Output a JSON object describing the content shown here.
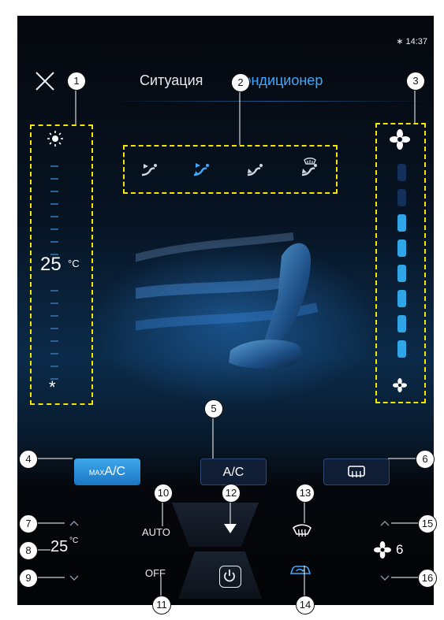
{
  "status_bar": {
    "bluetooth_icon": "bluetooth-icon",
    "time": "14:37"
  },
  "header": {
    "close_icon": "close-icon",
    "tabs": [
      {
        "label": "Ситуация",
        "active": false
      },
      {
        "label": "Кондиционер",
        "active": true
      }
    ]
  },
  "temperature_panel": {
    "sun_icon": "sun-icon",
    "value": "25",
    "unit": "°C",
    "snowflake_icon": "snowflake-icon"
  },
  "airflow_modes": [
    {
      "icon": "airflow-face-icon",
      "selected": false
    },
    {
      "icon": "airflow-face-feet-icon",
      "selected": true
    },
    {
      "icon": "airflow-feet-icon",
      "selected": false
    },
    {
      "icon": "airflow-feet-defrost-icon",
      "selected": false
    }
  ],
  "fan_panel": {
    "fan_icon_top": "fan-icon",
    "fan_icon_bottom": "fan-small-icon",
    "level": 6,
    "max_level": 8
  },
  "buttons": {
    "max_ac_prefix": "MAX",
    "max_ac_label": "A/C",
    "ac_label": "A/C",
    "rear_defrost_icon": "rear-defrost-icon"
  },
  "bottom_bar": {
    "auto_label": "AUTO",
    "off_label": "OFF",
    "left_temp": "25",
    "left_temp_unit": "°C",
    "fan_speed": "6",
    "front_defrost_icon": "front-defrost-icon",
    "recirculation_icon": "recirculation-icon",
    "power_icon": "power-icon",
    "collapse_icon": "triangle-down-icon"
  },
  "callouts": [
    "1",
    "2",
    "3",
    "4",
    "5",
    "6",
    "7",
    "8",
    "9",
    "10",
    "11",
    "12",
    "13",
    "14",
    "15",
    "16"
  ],
  "colors": {
    "accent": "#3ea9ff",
    "highlight_box": "#f3e600",
    "fan_bar_active": "#2fa6e8",
    "fan_bar_inactive": "#12305a",
    "max_ac_button": "#2a8fd8"
  }
}
